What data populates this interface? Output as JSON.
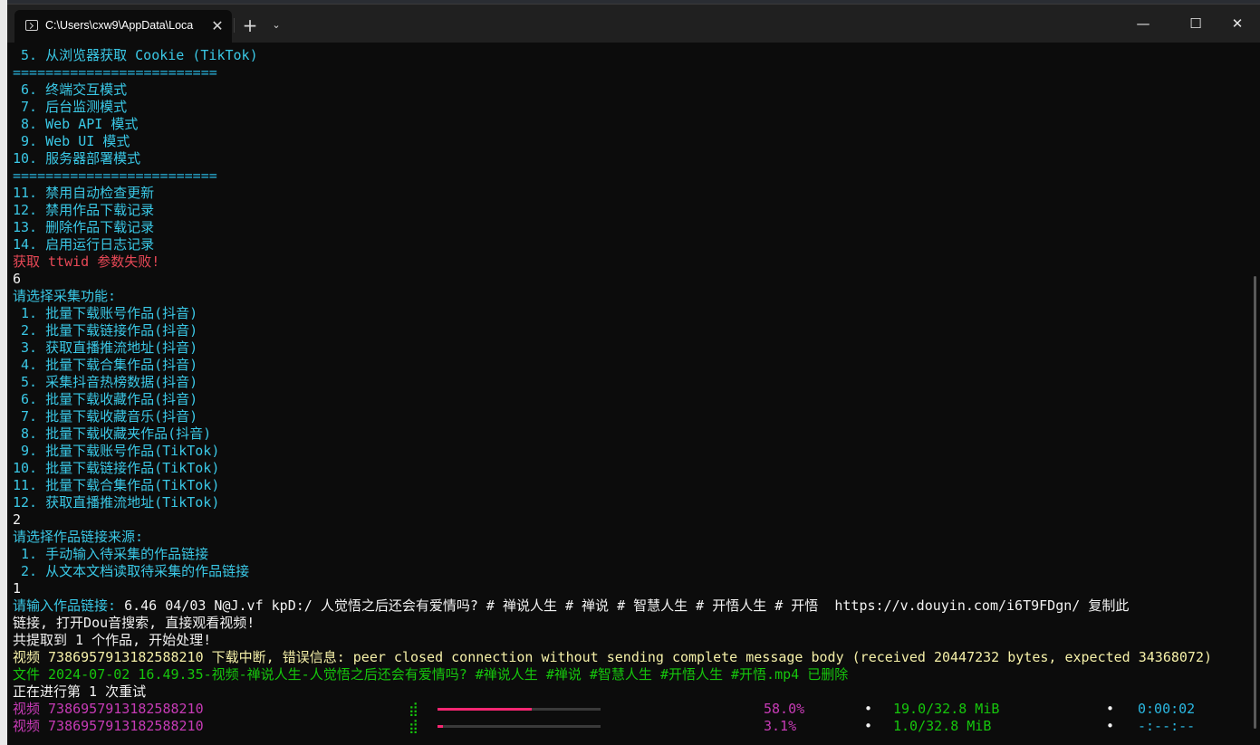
{
  "window": {
    "tab_title": "C:\\Users\\cxw9\\AppData\\Loca",
    "tab_close": "✕",
    "new_tab": "+",
    "tab_dropdown": "⌄",
    "minimize": "—",
    "maximize": "☐",
    "close": "✕"
  },
  "terminal": {
    "menu_top": [
      " 5. 从浏览器获取 Cookie (TikTok)",
      "=========================",
      " 6. 终端交互模式",
      " 7. 后台监测模式",
      " 8. Web API 模式",
      " 9. Web UI 模式",
      "10. 服务器部署模式",
      "=========================",
      "11. 禁用自动检查更新",
      "12. 禁用作品下载记录",
      "13. 删除作品下载记录",
      "14. 启用运行日志记录"
    ],
    "error_ttwid": "获取 ttwid 参数失败!",
    "input_1": "6",
    "prompt_feature": "请选择采集功能:",
    "feature_options": [
      " 1. 批量下载账号作品(抖音)",
      " 2. 批量下载链接作品(抖音)",
      " 3. 获取直播推流地址(抖音)",
      " 4. 批量下载合集作品(抖音)",
      " 5. 采集抖音热榜数据(抖音)",
      " 6. 批量下载收藏作品(抖音)",
      " 7. 批量下载收藏音乐(抖音)",
      " 8. 批量下载收藏夹作品(抖音)",
      " 9. 批量下载账号作品(TikTok)",
      "10. 批量下载链接作品(TikTok)",
      "11. 批量下载合集作品(TikTok)",
      "12. 获取直播推流地址(TikTok)"
    ],
    "input_2": "2",
    "prompt_source": "请选择作品链接来源:",
    "source_options": [
      " 1. 手动输入待采集的作品链接",
      " 2. 从文本文档读取待采集的作品链接"
    ],
    "input_3": "1",
    "prompt_link": "请输入作品链接:",
    "link_value_line1": " 6.46 04/03 N@J.vf kpD:/ 人觉悟之后还会有爱情吗? # 禅说人生 # 禅说 # 智慧人生 # 开悟人生 # 开悟  https://v.douyin.com/i6T9FDgn/ 复制此",
    "link_value_line2": "链接, 打开Dou音搜索, 直接观看视频!",
    "extracted": "共提取到 1 个作品, 开始处理!",
    "download_error": "视频 7386957913182588210 下载中断, 错误信息: peer closed connection without sending complete message body (received 20447232 bytes, expected 34368072)",
    "file_deleted": "文件 2024-07-02 16.49.35-视频-禅说人生-人觉悟之后还会有爱情吗? #禅说人生 #禅说 #智慧人生 #开悟人生 #开悟.mp4 已删除",
    "retry": "正在进行第 1 次重试",
    "progress": [
      {
        "label": "视频 7386957913182588210",
        "spinner": "⣾",
        "fraction": 0.58,
        "percent": "58.0%",
        "dot1": "•",
        "size": "19.0/32.8 MiB",
        "dot2": "•",
        "time": "0:00:02"
      },
      {
        "label": "视频 7386957913182588210",
        "spinner": "⣾",
        "fraction": 0.031,
        "percent": "3.1%",
        "dot1": "•",
        "size": "1.0/32.8 MiB",
        "dot2": "•",
        "time": "-:--:--"
      }
    ]
  },
  "colors": {
    "menu": "#3ac8e6",
    "error": "#e74856",
    "success": "#16c60c",
    "warning": "#f5f0a8",
    "progress_label": "#c73bb6",
    "progress_bar": "#f92672"
  }
}
